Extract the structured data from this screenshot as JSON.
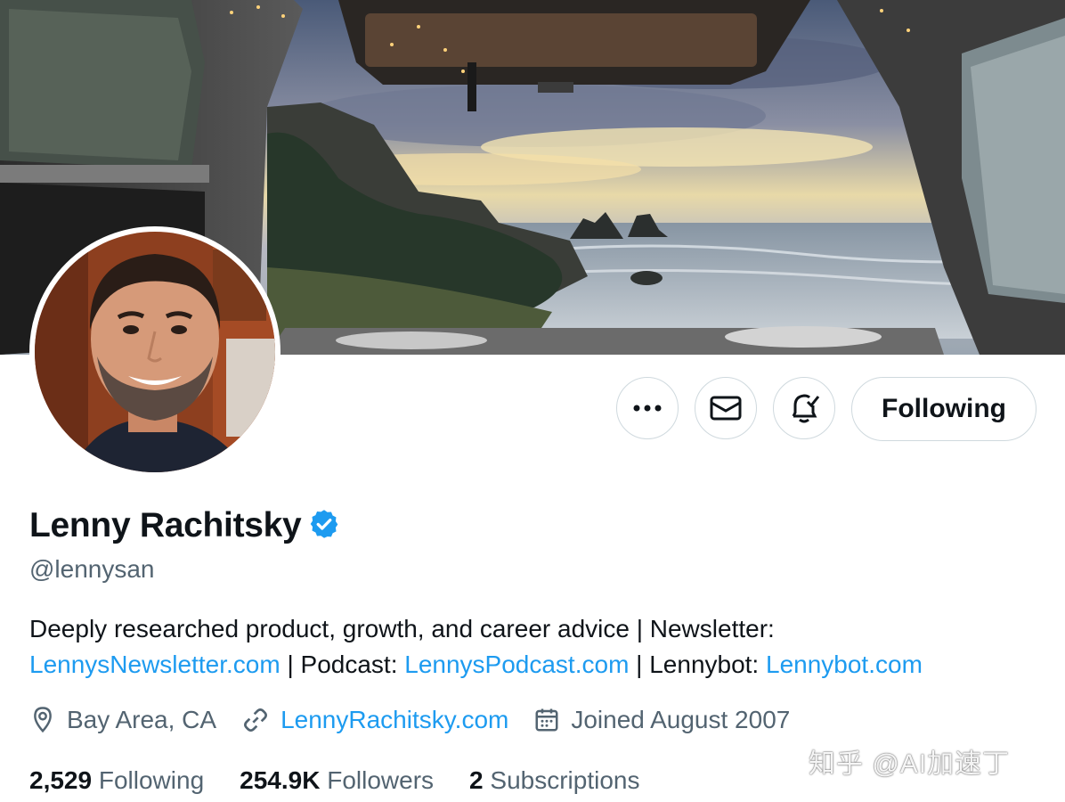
{
  "profile": {
    "name": "Lenny Rachitsky",
    "handle": "@lennysan",
    "bio_line1": "Deeply researched product, growth, and career advice | Newsletter:",
    "bio_line2": {
      "link1": "LennysNewsletter.com",
      "sep1": " | Podcast: ",
      "link2": "LennysPodcast.com",
      "sep2": " | Lennybot: ",
      "link3": "Lennybot.com"
    },
    "location": "Bay Area, CA",
    "website": "LennyRachitsky.com",
    "joined": "Joined August 2007"
  },
  "stats": {
    "following_count": "2,529",
    "following_label": "Following",
    "followers_count": "254.9K",
    "followers_label": "Followers",
    "subscriptions_count": "2",
    "subscriptions_label": "Subscriptions"
  },
  "actions": {
    "more_icon": "more-icon",
    "message_icon": "mail-icon",
    "notify_icon": "bell-check-icon",
    "follow_label": "Following"
  },
  "watermark": "知乎 @AI加速丁",
  "colors": {
    "link": "#1d9bf0",
    "verified": "#1d9bf0",
    "text_primary": "#0f1419",
    "text_secondary": "#536471",
    "border": "#cfd9de"
  }
}
